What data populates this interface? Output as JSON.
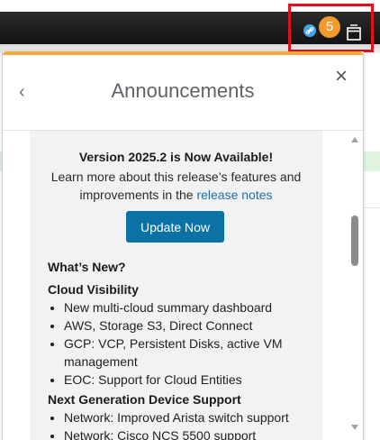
{
  "header": {
    "notification_count": "5",
    "link_icon": "link-icon",
    "window_icon": "window-icon",
    "colors": {
      "bar": "#1b1b1b",
      "badge": "#f29a2e",
      "link_badge": "#3ea7e8",
      "highlight": "#e0101c"
    }
  },
  "panel": {
    "title": "Announcements",
    "back_icon": "chevron-left-icon",
    "back_glyph": "‹",
    "close_icon": "close-icon",
    "close_glyph": "×",
    "accent_color": "#f6a93a"
  },
  "announcement": {
    "version_title": "Version 2025.2 is Now Available!",
    "desc_line1": "Learn more about this release’s features and",
    "desc_line2_prefix": "improvements in the ",
    "release_link": "release notes",
    "update_button": "Update Now",
    "button_color": "#0c71a5"
  },
  "whats_new": {
    "heading": "What’s New?",
    "sections": [
      {
        "title": "Cloud Visibility",
        "items": [
          "New multi-cloud summary dashboard",
          "AWS, Storage S3, Direct Connect",
          "GCP: VCP, Persistent Disks, active VM management",
          "EOC: Support for Cloud Entities"
        ]
      },
      {
        "title": "Next Generation Device Support",
        "items": [
          "Network: Improved Arista switch support",
          "Network: Cisco NCS 5500 support"
        ]
      }
    ]
  }
}
